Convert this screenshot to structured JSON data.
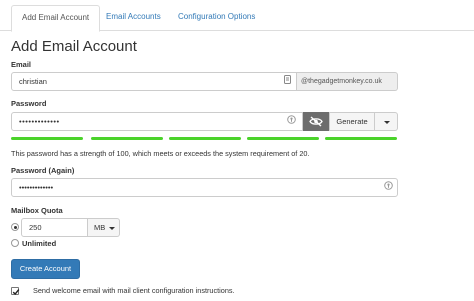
{
  "tabs": [
    {
      "label": "Add Email Account"
    },
    {
      "label": "Email Accounts"
    },
    {
      "label": "Configuration Options"
    }
  ],
  "page_title": "Add Email Account",
  "email": {
    "label": "Email",
    "value": "christian",
    "domain": "@thegadgetmonkey.co.uk"
  },
  "password": {
    "label": "Password",
    "value": "•••••••••••••",
    "generate_label": "Generate",
    "strength_message": "This password has a strength of 100, which meets or exceeds the system requirement of 20.",
    "strength_color": "#4bd32b"
  },
  "password_again": {
    "label": "Password (Again)",
    "value": "•••••••••••••"
  },
  "quota": {
    "label": "Mailbox Quota",
    "value": "250",
    "unit": "MB",
    "unlimited_label": "Unlimited"
  },
  "create_button": "Create Account",
  "welcome_email": {
    "label": "Send welcome email with mail client configuration instructions.",
    "checked": true
  },
  "colors": {
    "accent": "#337ab7",
    "reveal_button": "#6d6d6d"
  }
}
